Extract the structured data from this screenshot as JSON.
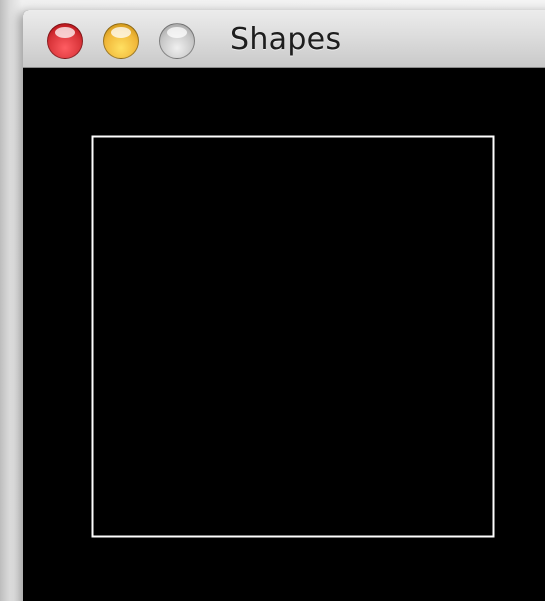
{
  "window": {
    "title": "Shapes"
  },
  "traffic_lights": {
    "close": {
      "color": "#d9353a",
      "icon": "close-dot"
    },
    "minimize": {
      "color": "#f1b83a",
      "icon": "minimize-dot"
    },
    "zoom": {
      "color": "#c8c8c8",
      "icon": "zoom-dot-disabled"
    }
  },
  "canvas": {
    "background": "#000000",
    "shapes": [
      {
        "type": "square-outline",
        "stroke": "#ffffff"
      }
    ]
  }
}
